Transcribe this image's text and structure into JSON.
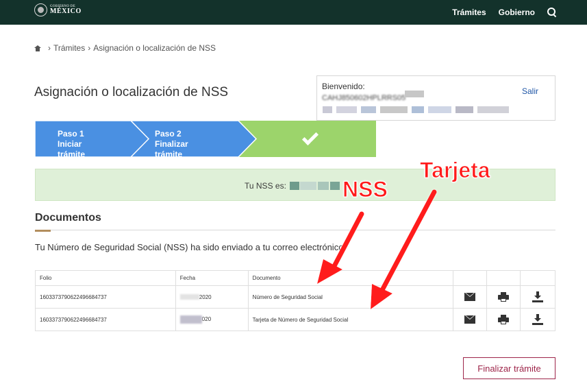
{
  "header": {
    "logo_small": "GOBIERNO DE",
    "logo_large": "MÉXICO",
    "nav": [
      "Trámites",
      "Gobierno"
    ]
  },
  "breadcrumb": [
    "Trámites",
    "Asignación o localización de NSS"
  ],
  "page_title": "Asignación o localización de NSS",
  "welcome": {
    "label": "Bienvenido:",
    "curp": "CAHJ850602HPLRRS05",
    "logout": "Salir"
  },
  "stepper": {
    "step1_title": "Paso 1",
    "step1_sub": "Iniciar trámite",
    "step2_title": "Paso 2",
    "step2_sub": "Finalizar trámite",
    "colors": {
      "active": "#4a90e2",
      "done": "#9cd46b"
    }
  },
  "nss_message": "Tu NSS es:",
  "documents": {
    "title": "Documentos",
    "description": "Tu Número de Seguridad Social (NSS) ha sido enviado a tu correo electrónico.",
    "columns": [
      "Folio",
      "Fecha",
      "Documento"
    ],
    "rows": [
      {
        "folio": "1603373790622496684737",
        "fecha_visible": "2020",
        "documento": "Número de Seguridad Social"
      },
      {
        "folio": "1603373790622496684737",
        "fecha_visible": "020",
        "documento": "Tarjeta de Número de Seguridad Social"
      }
    ],
    "action_icons": [
      "mail-icon",
      "print-icon",
      "download-icon"
    ]
  },
  "annotations": {
    "nss": "NSS",
    "tarjeta": "Tarjeta"
  },
  "finish_button": "Finalizar trámite",
  "colors": {
    "header_bg": "#13322b",
    "brand_button": "#9d2449",
    "annotation": "#ff1a1a",
    "success_bg": "#dff0d8"
  }
}
